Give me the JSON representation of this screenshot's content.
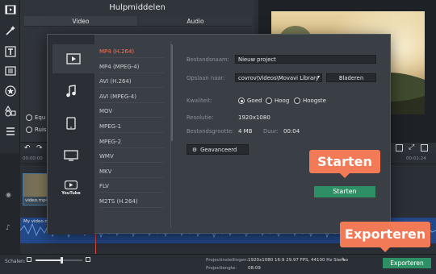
{
  "tools_panel": {
    "title": "Hulpmiddelen",
    "tabs": [
      "Video",
      "Audio"
    ],
    "radio_labels": [
      "Equ",
      "Ruis"
    ]
  },
  "dialog": {
    "categories": [
      "video-format-icon",
      "music-icon",
      "tablet-icon",
      "tv-icon",
      "youtube-icon"
    ],
    "youtube_label": "YouTube",
    "formats": [
      "MP4 (H.264)",
      "MP4 (MPEG-4)",
      "AVI (H.264)",
      "AVI (MPEG-4)",
      "MOV",
      "MPEG-1",
      "MPEG-2",
      "WMV",
      "MKV",
      "FLV",
      "M2TS (H.264)"
    ],
    "active_format": 0,
    "fields": {
      "filename_label": "Bestandsnaam:",
      "filename_value": "Nieuw project",
      "save_label": "Opslaan naar:",
      "save_value": "covrov\\Videos\\Movavi Library",
      "browse_label": "Bladeren",
      "quality_label": "Kwaliteit:",
      "quality_options": [
        "Goed",
        "Hoog",
        "Hoogste"
      ],
      "quality_selected": "Goed",
      "resolution_label": "Resolutie:",
      "resolution_value": "1920x1080",
      "filesize_label": "Bestandsgrootte:",
      "filesize_value": "4 MB",
      "duration_label": "Duur:",
      "duration_value": "00:04",
      "advanced_label": "Geavanceerd"
    },
    "start_button": "Starten"
  },
  "callouts": {
    "start": "Starten",
    "export": "Exporteren"
  },
  "timeline": {
    "ruler_left": "00:00:00",
    "ruler_right": "00:01:24",
    "clip_name": "video.mp4",
    "audio_name": "My video.mp4"
  },
  "status": {
    "scale_label": "Schalen:",
    "project_settings_label": "Projectinstellingen:",
    "project_settings_value": "1920x1080 16:9 29.97 FPS, 44100 Hz Stereo",
    "project_length_label": "Projectlengte:",
    "project_length_value": "08:09",
    "export_button": "Exporteren"
  },
  "colors": {
    "accent_orange": "#f37a57",
    "accent_green": "#2f8f64",
    "audio_blue": "#23498a",
    "selected_format": "#ff6f4d"
  }
}
